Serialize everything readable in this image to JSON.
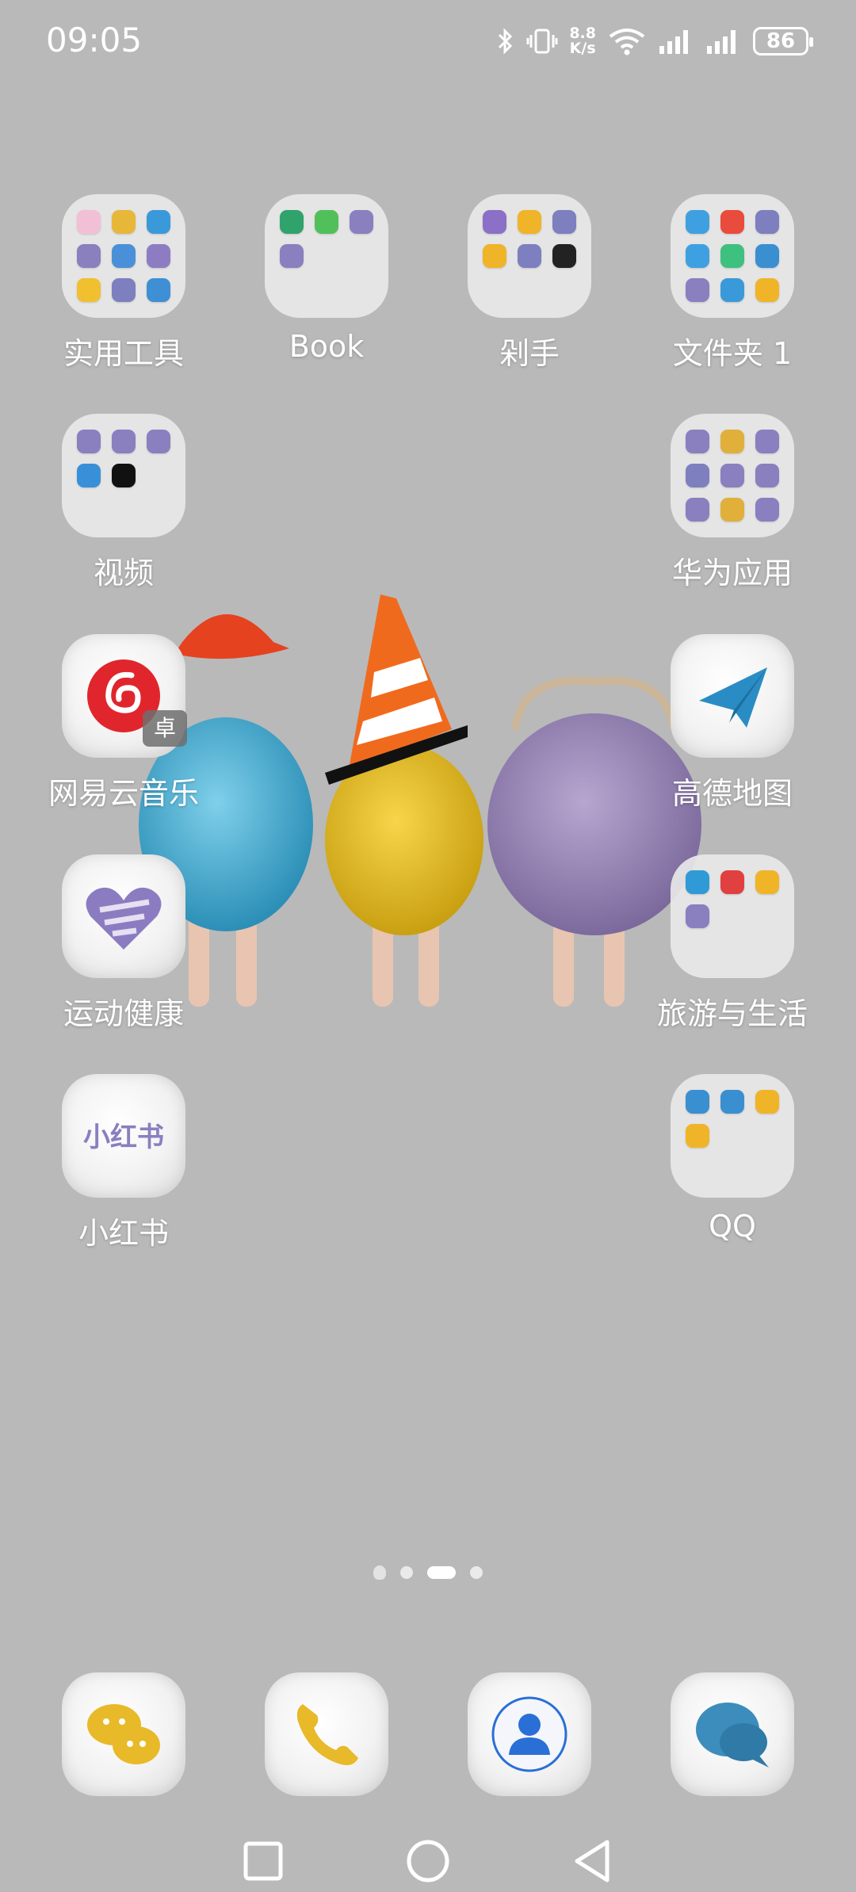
{
  "status_bar": {
    "time": "09:05",
    "net_speed_value": "8.8",
    "net_speed_unit": "K/s",
    "battery": "86",
    "icons": [
      "bluetooth-icon",
      "vibrate-icon",
      "wifi-icon",
      "signal-icon",
      "signal-icon",
      "battery-icon"
    ]
  },
  "grid": [
    {
      "label": "实用工具",
      "type": "folder",
      "minis": [
        "#f2c0d6",
        "#e7b73a",
        "#3a9ad9",
        "#8a7fbf",
        "#4a90d9",
        "#8e7cc3",
        "#f0c030",
        "#7d7fbf",
        "#3e8fd4"
      ]
    },
    {
      "label": "Book",
      "type": "folder",
      "minis": [
        "#2fa36b",
        "#52c05a",
        "#8a7fbf",
        "#8a7fbf"
      ]
    },
    {
      "label": "剁手",
      "type": "folder",
      "minis": [
        "#8c6fc6",
        "#f0b429",
        "#7d7fbf",
        "#f0b429",
        "#7d7fbf",
        "#222222"
      ]
    },
    {
      "label": "文件夹 1",
      "type": "folder",
      "minis": [
        "#3ea0e0",
        "#e94b3c",
        "#7d7fbf",
        "#3ea0e0",
        "#3ec07e",
        "#3a8fd0",
        "#8a7fbf",
        "#3a9ad9",
        "#f0b429"
      ]
    },
    {
      "label": "视频",
      "type": "folder",
      "minis": [
        "#8a7fbf",
        "#8a7fbf",
        "#8a7fbf",
        "#3a8fd9",
        "#111111"
      ]
    },
    {
      "label": "华为应用",
      "type": "folder",
      "minis": [
        "#8a7fbf",
        "#e0b03a",
        "#8a7fbf",
        "#7d7fbf",
        "#8a7fbf",
        "#8a7fbf",
        "#8a7fbf",
        "#e0b03a",
        "#8a7fbf"
      ]
    },
    {
      "label": "网易云音乐",
      "type": "app",
      "badge": "卓"
    },
    {
      "label": "高德地图",
      "type": "app"
    },
    {
      "label": "运动健康",
      "type": "app"
    },
    {
      "label": "旅游与生活",
      "type": "folder",
      "minis": [
        "#2f9ad6",
        "#e04040",
        "#f0b429",
        "#8a7fbf"
      ]
    },
    {
      "label": "小红书",
      "type": "app",
      "logo_text": "小红书"
    },
    {
      "label": "QQ",
      "type": "folder",
      "minis": [
        "#3a8fd0",
        "#3a8fd0",
        "#f0b429",
        "#f0b429"
      ]
    }
  ],
  "dock": [
    "messages-app",
    "phone-app",
    "contacts-app",
    "chat-app"
  ],
  "page_indicator": {
    "count": 3,
    "active": 2
  }
}
